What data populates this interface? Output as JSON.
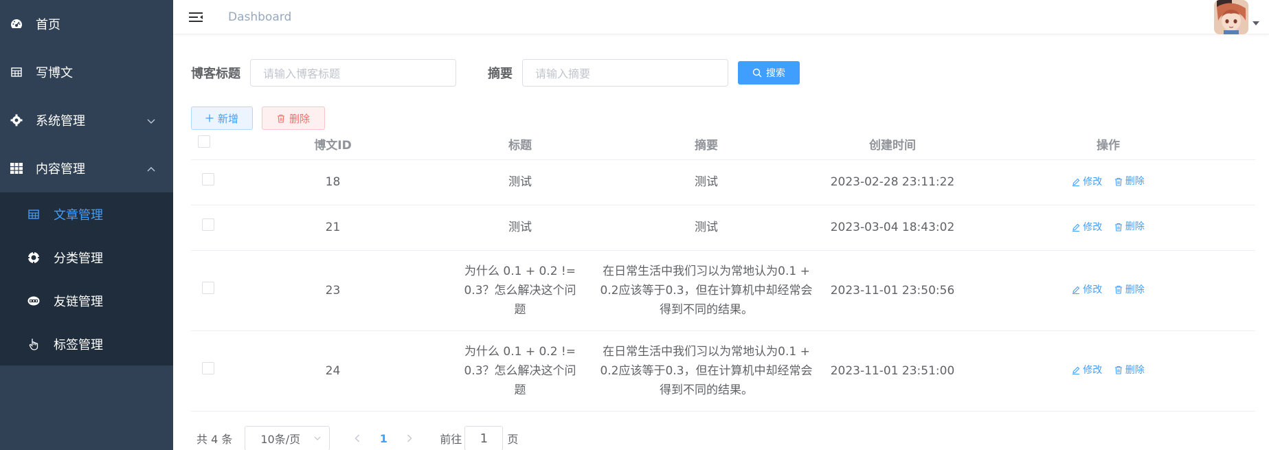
{
  "sidebar": {
    "items": [
      {
        "label": "首页",
        "icon": "dashboard-icon"
      },
      {
        "label": "写博文",
        "icon": "table-icon"
      },
      {
        "label": "系统管理",
        "icon": "gear-icon",
        "expanded": false
      },
      {
        "label": "内容管理",
        "icon": "grid-icon",
        "expanded": true
      }
    ],
    "subitems": [
      {
        "label": "文章管理",
        "icon": "table-icon",
        "active": true
      },
      {
        "label": "分类管理",
        "icon": "lifebuoy-icon",
        "active": false
      },
      {
        "label": "友链管理",
        "icon": "link-icon",
        "active": false
      },
      {
        "label": "标签管理",
        "icon": "pointer-icon",
        "active": false
      }
    ]
  },
  "navbar": {
    "breadcrumb": "Dashboard"
  },
  "search": {
    "title_label": "博客标题",
    "title_placeholder": "请输入博客标题",
    "summary_label": "摘要",
    "summary_placeholder": "请输入摘要",
    "search_button": "搜索"
  },
  "actions": {
    "add_button": "新增",
    "delete_button": "删除"
  },
  "table": {
    "columns": [
      "博文ID",
      "标题",
      "摘要",
      "创建时间",
      "操作"
    ],
    "rows": [
      {
        "id": "18",
        "title": "测试",
        "summary": "测试",
        "created": "2023-02-28 23:11:22"
      },
      {
        "id": "21",
        "title": "测试",
        "summary": "测试",
        "created": "2023-03-04 18:43:02"
      },
      {
        "id": "23",
        "title": "为什么 0.1 + 0.2 != 0.3？怎么解决这个问题",
        "summary": "在日常生活中我们习以为常地认为0.1 + 0.2应该等于0.3，但在计算机中却经常会得到不同的结果。",
        "created": "2023-11-01 23:50:56"
      },
      {
        "id": "24",
        "title": "为什么 0.1 + 0.2 != 0.3？怎么解决这个问题",
        "summary": "在日常生活中我们习以为常地认为0.1 + 0.2应该等于0.3，但在计算机中却经常会得到不同的结果。",
        "created": "2023-11-01 23:51:00"
      }
    ],
    "edit_label": "修改",
    "delete_label": "删除"
  },
  "pagination": {
    "total": "共 4 条",
    "page_size": "10条/页",
    "current_page": "1",
    "goto_label": "前往",
    "goto_value": "1",
    "goto_unit": "页"
  },
  "colors": {
    "sidebar_bg": "#304156",
    "submenu_bg": "#1f2d3d",
    "primary": "#409eff",
    "danger": "#f56c6c"
  }
}
